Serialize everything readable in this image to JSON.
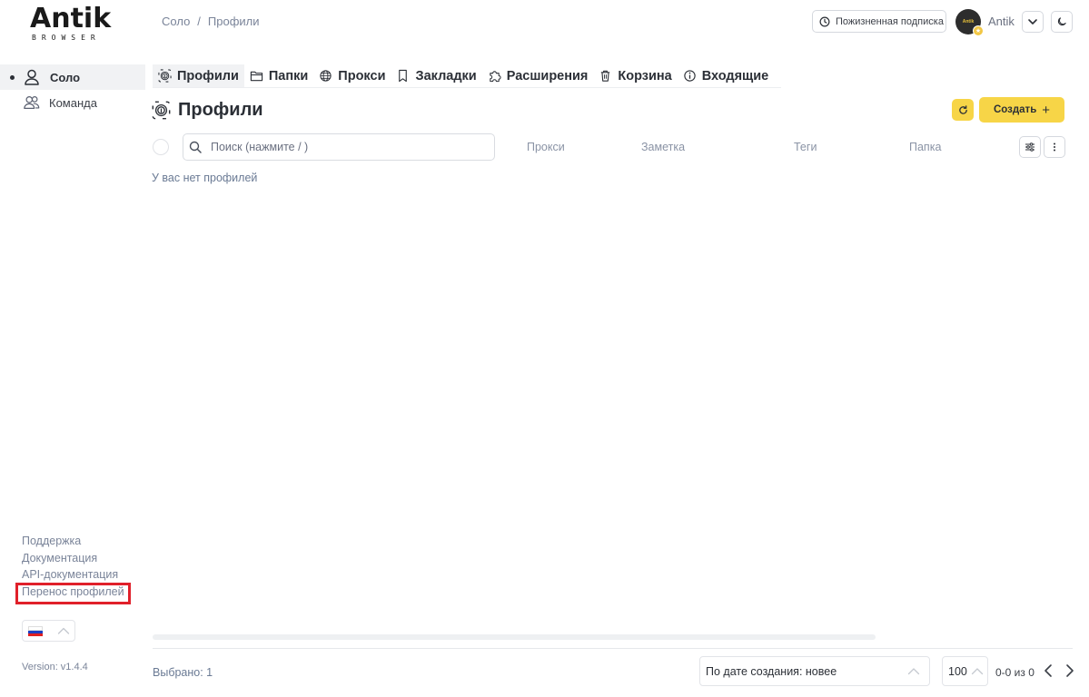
{
  "logo": {
    "main": "Antik",
    "sub": "BROWSER"
  },
  "breadcrumb": {
    "items": [
      "Соло",
      "/",
      "Профили"
    ]
  },
  "header": {
    "subscription_label": "Пожизненная подписка",
    "avatar_text": "Antik",
    "user_name": "Antik",
    "icons": [
      "clock-icon",
      "chevron-down-icon",
      "moon-icon"
    ]
  },
  "sidebar": {
    "items": [
      {
        "label": "Соло",
        "icon": "user-icon",
        "active": true
      },
      {
        "label": "Команда",
        "icon": "users-icon",
        "active": false
      }
    ],
    "links": [
      "Поддержка",
      "Документация",
      "API-документация",
      "Перенос профилей"
    ],
    "highlighted_link": "Перенос профилей",
    "version": "Version: v1.4.4",
    "language": "ru"
  },
  "tabs": [
    {
      "label": "Профили",
      "icon": "fingerprint-icon",
      "active": true
    },
    {
      "label": "Папки",
      "icon": "folder-icon",
      "active": false
    },
    {
      "label": "Прокси",
      "icon": "globe-icon",
      "active": false
    },
    {
      "label": "Закладки",
      "icon": "bookmark-icon",
      "active": false
    },
    {
      "label": "Расширения",
      "icon": "puzzle-icon",
      "active": false
    },
    {
      "label": "Корзина",
      "icon": "trash-icon",
      "active": false
    },
    {
      "label": "Входящие",
      "icon": "info-icon",
      "active": false
    }
  ],
  "main": {
    "title": "Профили",
    "create_label": "Создать",
    "search_placeholder": "Поиск (нажмите / )",
    "columns": [
      "Прокси",
      "Заметка",
      "Теги",
      "Папка"
    ],
    "empty_message": "У вас нет профилей"
  },
  "footer": {
    "selected": "Выбрано: 1",
    "sort_value": "По дате создания: новее",
    "per_page": "100",
    "range": "0-0 из 0"
  },
  "colors": {
    "accent": "#f7d547",
    "highlight": "#e0202a",
    "muted_text": "#7a8499"
  }
}
